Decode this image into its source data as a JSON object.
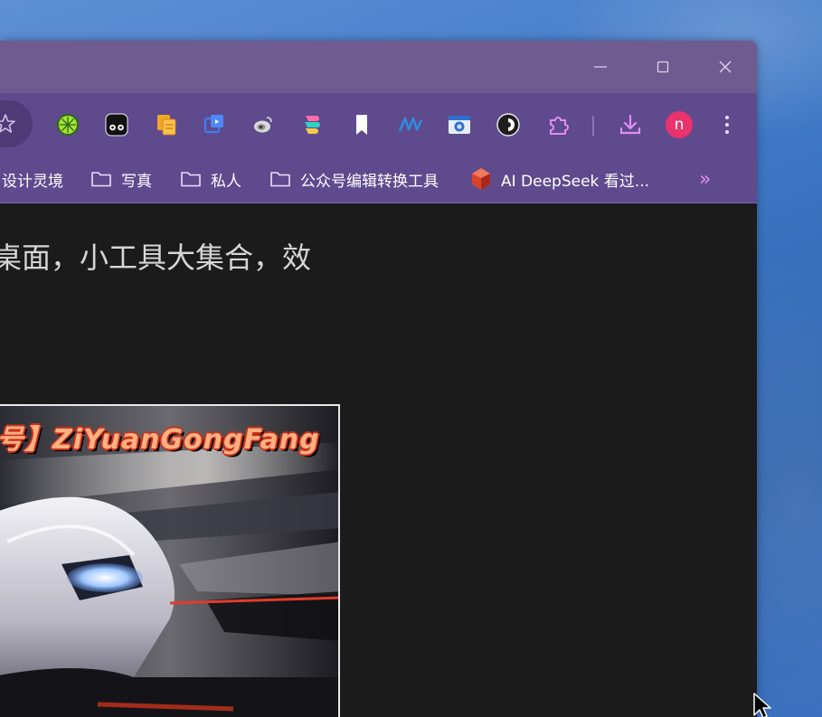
{
  "window": {
    "controls": [
      "minimize-icon",
      "maximize-icon",
      "close-icon"
    ]
  },
  "toolbar": {
    "star_icon": "star-icon",
    "extensions": [
      "lime-icon",
      "face-icon",
      "copy-docs-icon",
      "screen-capture-icon",
      "weibo-icon",
      "layers-icon",
      "bookmark-icon",
      "waveform-icon",
      "camera-screenshot-icon",
      "circle-dark-icon",
      "puzzle-extensions-icon"
    ],
    "download_icon": "download-icon",
    "profile_initial": "n",
    "menu_icon": "kebab-menu-icon"
  },
  "bookmarks": {
    "items": [
      {
        "label": "设计灵境",
        "icon": "none"
      },
      {
        "label": "写真",
        "icon": "folder-icon"
      },
      {
        "label": "私人",
        "icon": "folder-icon"
      },
      {
        "label": "公众号编辑转换工具",
        "icon": "folder-icon"
      },
      {
        "label": "AI DeepSeek 看过...",
        "icon": "ruby-icon"
      }
    ],
    "overflow": "»"
  },
  "content": {
    "headline": "桌面，小工具大集合，效",
    "poster_title": "号】ZiYuanGongFang"
  },
  "colors": {
    "titlebar": "#6f5b8f",
    "toolbar": "#5f4a8e",
    "content_bg": "#1b1b1b",
    "profile_avatar": "#e8336d",
    "accent_icon": "#e28df0"
  }
}
